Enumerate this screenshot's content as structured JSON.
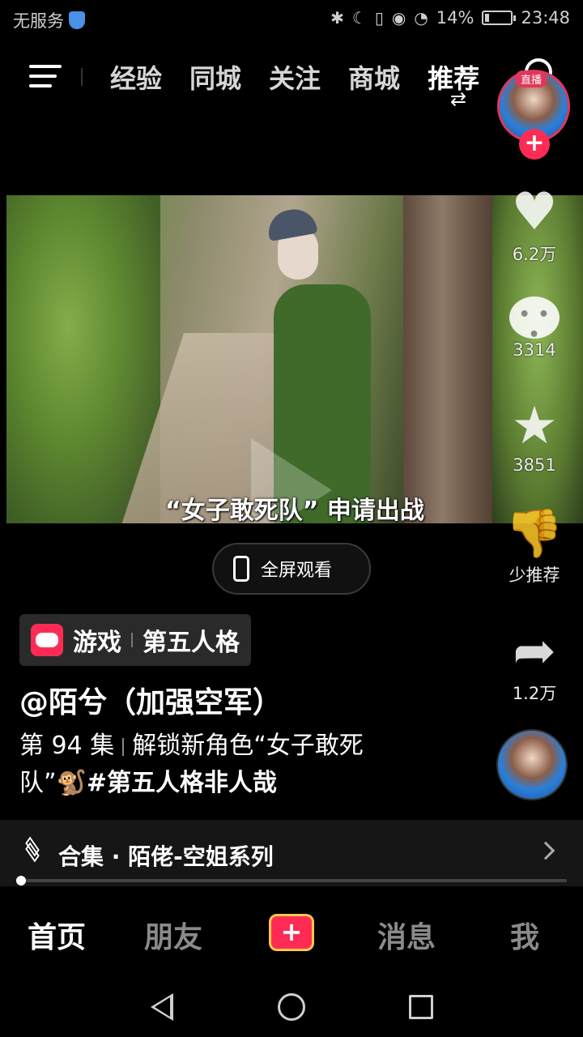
{
  "status_bar": {
    "carrier": "无服务",
    "battery": "14%",
    "battery_level": 0.14,
    "time": "23:48",
    "icons": [
      "shield-icon",
      "bluetooth-icon",
      "moon-icon",
      "vibrate-icon",
      "eye-icon",
      "wifi-icon",
      "battery-icon"
    ]
  },
  "top_nav": {
    "tabs": [
      "经验",
      "同城",
      "关注",
      "商城",
      "推荐"
    ],
    "active_tab": "推荐",
    "switch_glyph": "⇄"
  },
  "video": {
    "subtitle": "“女子敢死队” 申请出战"
  },
  "side_actions": {
    "live_badge": "直播",
    "follow_glyph": "+",
    "likes": "6.2万",
    "comments": "3314",
    "favorites": "3851",
    "dislike_label": "少推荐",
    "shares": "1.2万",
    "like_glyph": "♥",
    "star_glyph": "★",
    "dislike_glyph": "👎",
    "share_glyph": "➦"
  },
  "fullscreen": {
    "label": "全屏观看"
  },
  "tag": {
    "category": "游戏",
    "game": "第五人格"
  },
  "author": "@陌兮（加强空军）",
  "description": {
    "episode": "第 94 集",
    "text": "解锁新角色“女子敢死队”🐒",
    "hashtag": "#第五人格非人哉"
  },
  "collection": {
    "label": "合集 · 陌佬-空姐系列"
  },
  "progress": {
    "fraction": 0.005
  },
  "bottom_nav": {
    "home": "首页",
    "friends": "朋友",
    "create": "+",
    "messages": "消息",
    "me": "我"
  },
  "colors": {
    "accent": "#fe2c55",
    "background": "#000000"
  }
}
